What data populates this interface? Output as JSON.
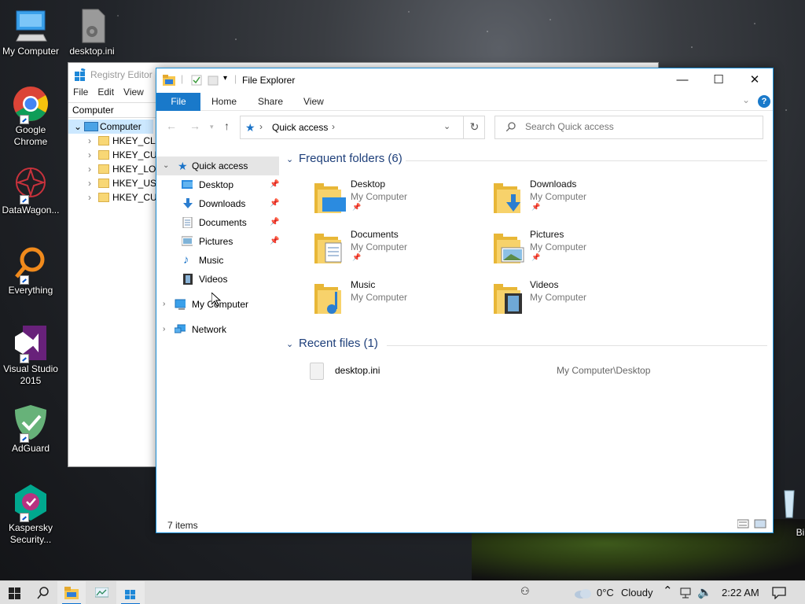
{
  "desktop": {
    "icons": [
      {
        "label": "My Computer",
        "icon": "computer-icon"
      },
      {
        "label": "desktop.ini",
        "icon": "settings-file-icon"
      },
      {
        "label": "Google Chrome",
        "icon": "chrome-icon"
      },
      {
        "label": "DataWagon...",
        "icon": "datawagon-icon"
      },
      {
        "label": "Everything",
        "icon": "everything-icon"
      },
      {
        "label": "Visual Studio 2015",
        "icon": "visual-studio-icon"
      },
      {
        "label": "AdGuard",
        "icon": "adguard-icon"
      },
      {
        "label": "Kaspersky Security...",
        "icon": "kaspersky-icon"
      },
      {
        "label": "Bin",
        "icon": "recycle-bin-icon"
      }
    ]
  },
  "regedit": {
    "title": "Registry Editor",
    "menu": [
      "File",
      "Edit",
      "View"
    ],
    "address": "Computer",
    "root": "Computer",
    "keys": [
      "HKEY_CLA",
      "HKEY_CUR",
      "HKEY_LOC",
      "HKEY_USE",
      "HKEY_CUR"
    ]
  },
  "explorer": {
    "title": "File Explorer",
    "ribbon": {
      "file": "File",
      "tabs": [
        "Home",
        "Share",
        "View"
      ],
      "help": "?"
    },
    "address": {
      "location": "Quick access"
    },
    "search_placeholder": "Search Quick access",
    "nav": {
      "quick_access": "Quick access",
      "pinned": [
        "Desktop",
        "Downloads",
        "Documents",
        "Pictures"
      ],
      "unpinned": [
        "Music",
        "Videos"
      ],
      "my_computer": "My Computer",
      "network": "Network"
    },
    "frequent": {
      "header": "Frequent folders (6)",
      "folders": [
        {
          "name": "Desktop",
          "location": "My Computer",
          "pinned": true
        },
        {
          "name": "Downloads",
          "location": "My Computer",
          "pinned": true
        },
        {
          "name": "Documents",
          "location": "My Computer",
          "pinned": true
        },
        {
          "name": "Pictures",
          "location": "My Computer",
          "pinned": true
        },
        {
          "name": "Music",
          "location": "My Computer",
          "pinned": false
        },
        {
          "name": "Videos",
          "location": "My Computer",
          "pinned": false
        }
      ]
    },
    "recent": {
      "header": "Recent files (1)",
      "files": [
        {
          "name": "desktop.ini",
          "path": "My Computer\\Desktop"
        }
      ]
    },
    "status": "7 items"
  },
  "taskbar": {
    "weather_temp": "0°C",
    "weather_desc": "Cloudy",
    "time": "2:22 AM"
  },
  "colors": {
    "accent": "#1979ca",
    "selection": "#e5e5e5",
    "group_header": "#1e3f7a"
  }
}
